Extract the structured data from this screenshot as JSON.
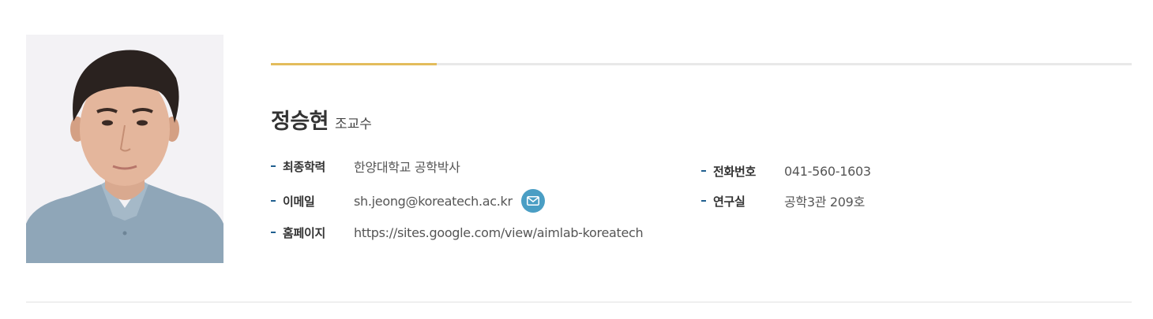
{
  "professor": {
    "name": "정승현",
    "position": "조교수"
  },
  "info": {
    "education": {
      "label": "최종학력",
      "value": "한양대학교 공학박사"
    },
    "email": {
      "label": "이메일",
      "value": "sh.jeong@koreatech.ac.kr",
      "icon": "mail-icon"
    },
    "homepage": {
      "label": "홈페이지",
      "value": "https://sites.google.com/view/aimlab-koreatech"
    },
    "phone": {
      "label": "전화번호",
      "value": "041-560-1603"
    },
    "office": {
      "label": "연구실",
      "value": "공학3관 209호"
    }
  },
  "colors": {
    "accent_gold": "#e3bc5c",
    "dash_blue": "#1f5f8f",
    "mail_button": "#4a9ec4"
  }
}
